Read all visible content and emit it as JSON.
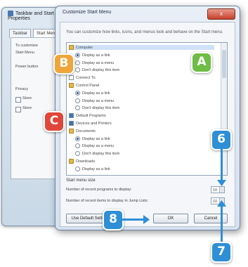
{
  "background_window": {
    "title": "Taskbar and Start Menu Properties",
    "tabs": [
      "Taskbar",
      "Start Menu"
    ],
    "text_lines": [
      "To customize",
      "Start Menu",
      "Power button"
    ],
    "privacy_label": "Privacy",
    "privacy_checks": [
      "Store",
      "Store"
    ]
  },
  "dialog": {
    "title": "Customize Start Menu",
    "close_label": "x",
    "description": "You can customize how links, icons, and menus look and behave on the Start menu.",
    "list_items": [
      {
        "type": "folder",
        "label": "Computer",
        "state": "selected"
      },
      {
        "type": "radio",
        "label": "Display as a link",
        "state": "on"
      },
      {
        "type": "radio",
        "label": "Display as a menu",
        "state": "off"
      },
      {
        "type": "radio",
        "label": "Don't display this item",
        "state": "off"
      },
      {
        "type": "plain",
        "label": "Connect To",
        "state": "off"
      },
      {
        "type": "folder",
        "label": "Control Panel",
        "state": "off"
      },
      {
        "type": "radio",
        "label": "Display as a link",
        "state": "on"
      },
      {
        "type": "radio",
        "label": "Display as a menu",
        "state": "off"
      },
      {
        "type": "radio",
        "label": "Don't display this item",
        "state": "off"
      },
      {
        "type": "checkbox",
        "label": "Default Programs",
        "state": "on"
      },
      {
        "type": "checkbox",
        "label": "Devices and Printers",
        "state": "on"
      },
      {
        "type": "folder",
        "label": "Documents",
        "state": "off"
      },
      {
        "type": "radio",
        "label": "Display as a link",
        "state": "on"
      },
      {
        "type": "radio",
        "label": "Display as a menu",
        "state": "off"
      },
      {
        "type": "radio",
        "label": "Don't display this item",
        "state": "off"
      },
      {
        "type": "folder",
        "label": "Downloads",
        "state": "off"
      },
      {
        "type": "radio",
        "label": "Display as a link",
        "state": "off"
      }
    ],
    "section_title": "Start menu size",
    "recent_programs_label": "Number of recent programs to display:",
    "recent_programs_value": "10",
    "jump_list_label": "Number of recent items to display in Jump Lists:",
    "jump_list_value": "10",
    "use_default_label": "Use Default Settings",
    "ok_label": "OK",
    "cancel_label": "Cancel"
  },
  "callouts": {
    "A": {
      "label": "A",
      "color": "#6ebd45"
    },
    "B": {
      "label": "B",
      "color": "#f0a53a"
    },
    "C": {
      "label": "C",
      "color": "#e1463a"
    },
    "six": {
      "label": "6",
      "color": "#2e8fd6"
    },
    "seven": {
      "label": "7",
      "color": "#2e8fd6"
    },
    "eight": {
      "label": "8",
      "color": "#2e8fd6"
    }
  }
}
